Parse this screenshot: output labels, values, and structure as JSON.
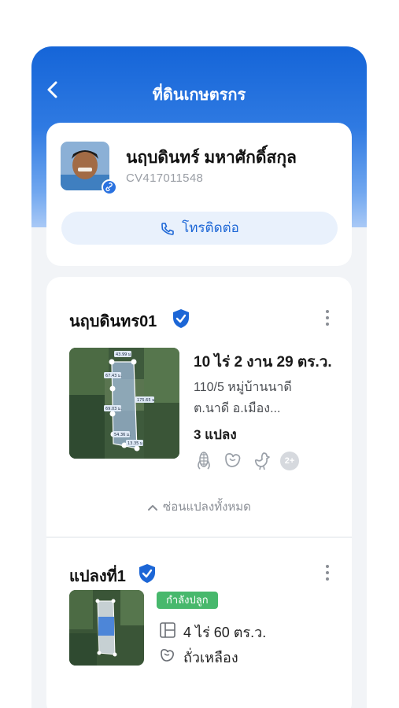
{
  "header": {
    "title": "ที่ดินเกษตรกร"
  },
  "profile": {
    "name": "นฤบดินทร์ มหาศักดิ์สกุล",
    "id": "CV417011548",
    "call_label": "โทรติดต่อ"
  },
  "farm": {
    "name": "นฤบดินทร01",
    "area": "10 ไร่ 2 งาน 29 ตร.ว.",
    "address_line1": "110/5 หมู่บ้านนาดี",
    "address_line2": "ต.นาดี อ.เมือง...",
    "plot_count": "3 แปลง",
    "crop_icons": [
      "corn-icon",
      "soybean-icon",
      "chicken-icon"
    ],
    "more_crops": "2+",
    "hide_label": "ซ่อนแปลงทั้งหมด",
    "map_labels": [
      "43.99 ม.",
      "67.43 ม.",
      "175.65 ม.",
      "69.03 ม.",
      "54.36 ม.",
      "13.35 ม."
    ]
  },
  "plot1": {
    "name": "แปลงที่1",
    "status": "กำลังปลูก",
    "area": "4 ไร่ 60 ตร.ว.",
    "crop": "ถั่วเหลือง"
  },
  "colors": {
    "primary": "#1565d8",
    "status_green": "#47b86c",
    "verified": "#1c66d6"
  }
}
